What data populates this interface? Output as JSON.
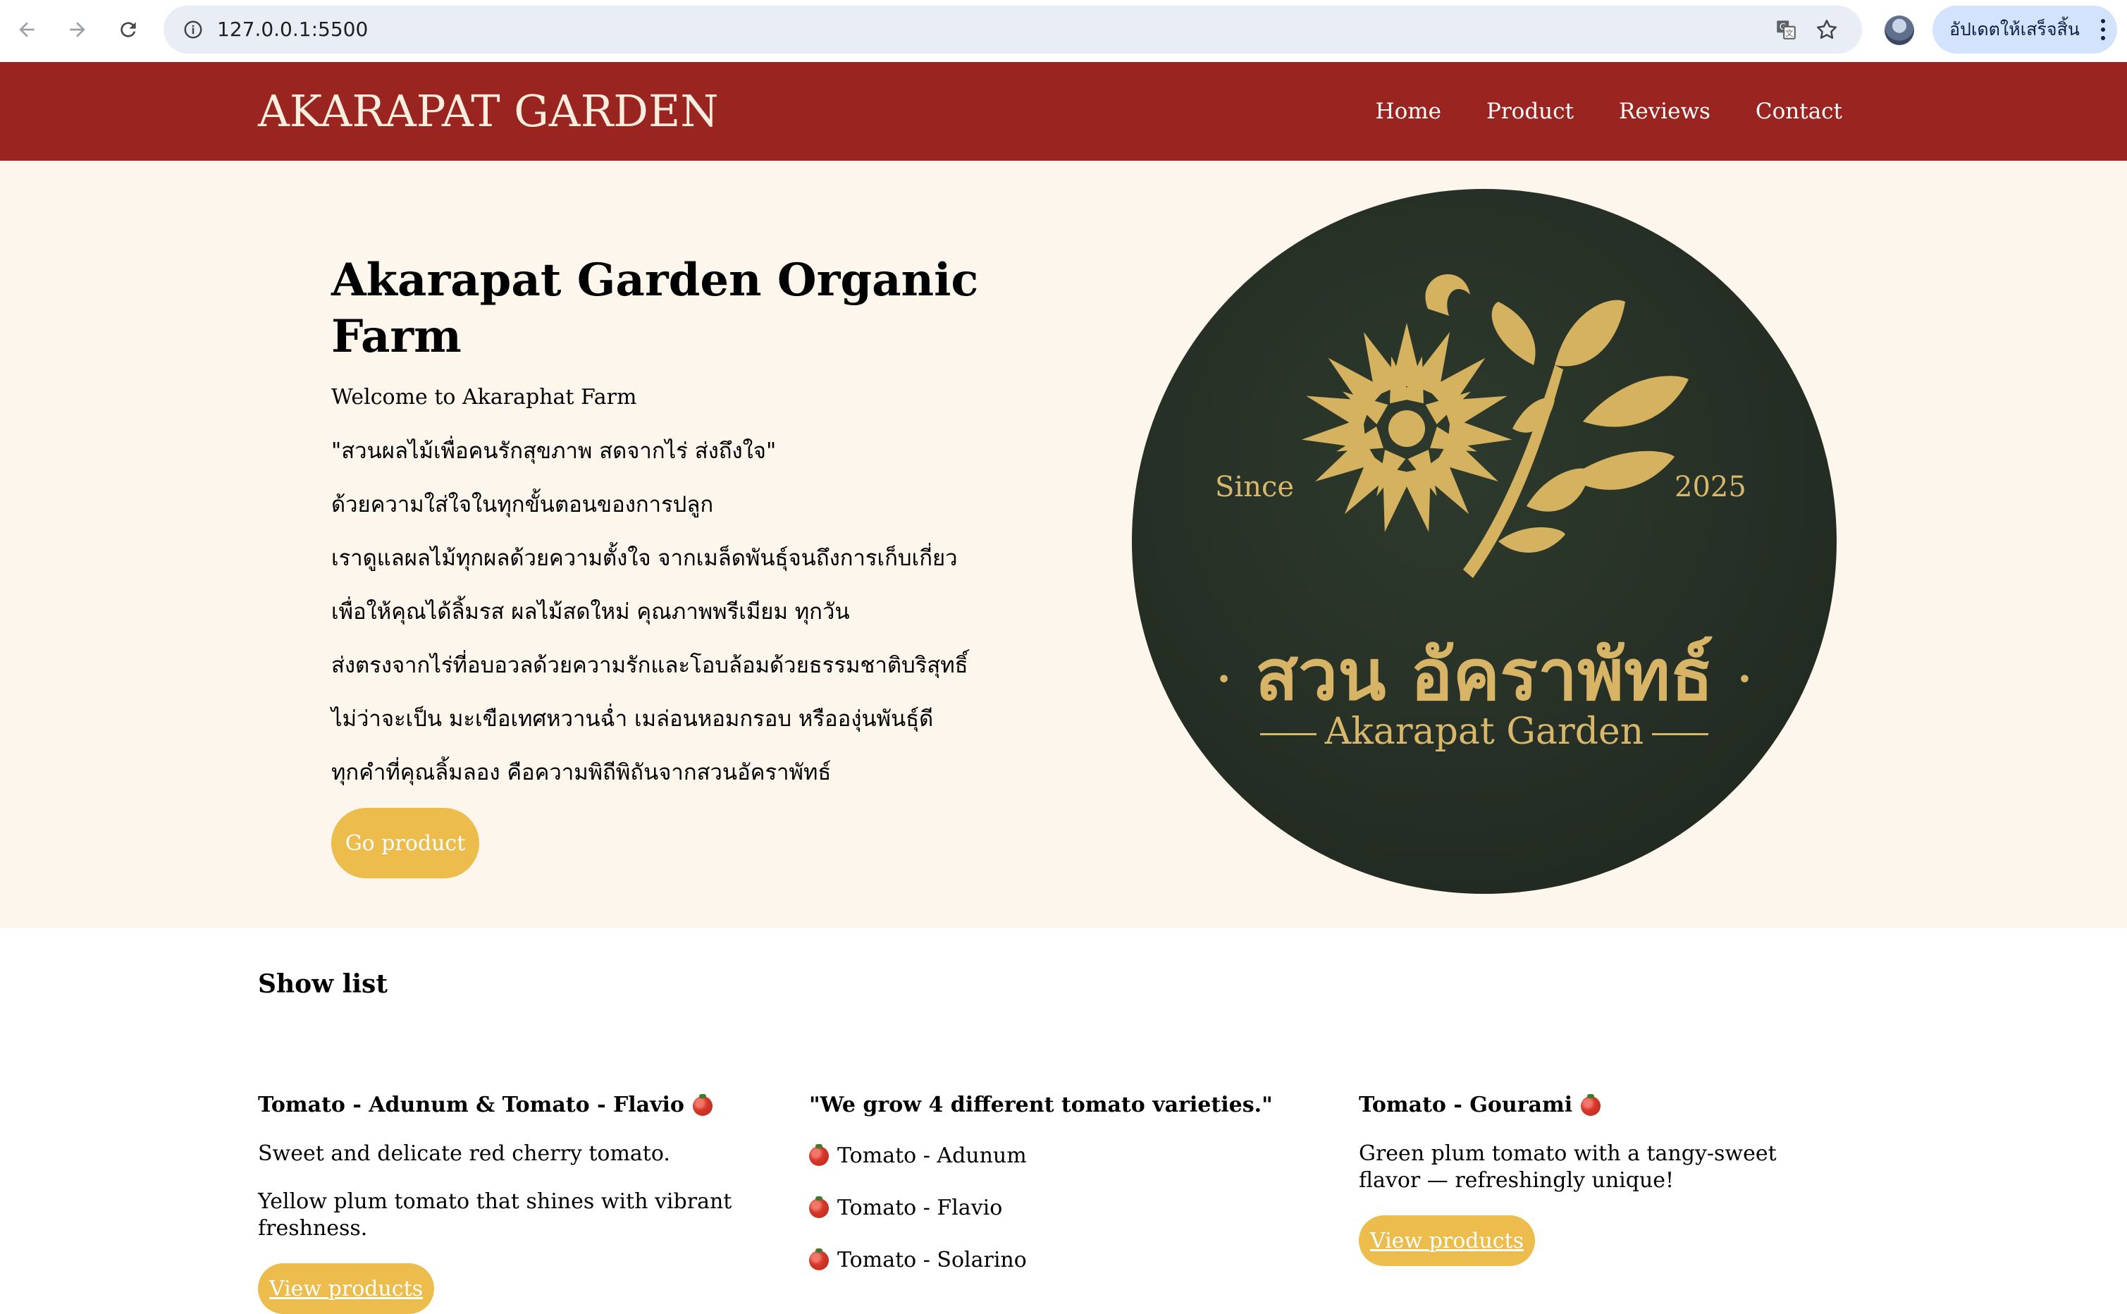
{
  "browser": {
    "url": "127.0.0.1:5500",
    "update_label": "อัปเดตให้เสร็จสิ้น"
  },
  "header": {
    "brand": "AKARAPAT GARDEN",
    "nav": [
      "Home",
      "Product",
      "Reviews",
      "Contact"
    ]
  },
  "hero": {
    "title": "Akarapat Garden Organic Farm",
    "welcome": "Welcome to Akaraphat Farm",
    "lines": [
      "\"สวนผลไม้เพื่อคนรักสุขภาพ สดจากไร่ ส่งถึงใจ\"",
      "ด้วยความใส่ใจในทุกขั้นตอนของการปลูก",
      "เราดูแลผลไม้ทุกผลด้วยความตั้งใจ จากเมล็ดพันธุ์จนถึงการเก็บเกี่ยว",
      "เพื่อให้คุณได้ลิ้มรส ผลไม้สดใหม่ คุณภาพพรีเมียม ทุกวัน",
      "ส่งตรงจากไร่ที่อบอวลด้วยความรักและโอบล้อมด้วยธรรมชาติบริสุทธิ์",
      "ไม่ว่าจะเป็น มะเขือเทศหวานฉ่ำ เมล่อนหอมกรอบ หรือองุ่นพันธุ์ดี",
      "ทุกคำที่คุณลิ้มลอง คือความพิถีพิถันจากสวนอัคราพัทธ์"
    ],
    "button": "Go product",
    "logo": {
      "since": "Since",
      "year": "2025",
      "thai_name": "สวน อัคราพัทธ์",
      "en_name": "Akarapat Garden"
    }
  },
  "show_list": {
    "title": "Show list",
    "col1": {
      "title": "Tomato - Adunum & Tomato - Flavio",
      "text1": "Sweet and delicate red cherry tomato.",
      "text2": "Yellow plum tomato that shines with vibrant freshness.",
      "button": "View products"
    },
    "col2": {
      "title": "\"We grow 4 different tomato varieties.\"",
      "items": [
        "Tomato - Adunum",
        "Tomato - Flavio",
        "Tomato - Solarino"
      ]
    },
    "col3": {
      "title": "Tomato - Gourami",
      "text1": "Green plum tomato with a tangy-sweet flavor — refreshingly unique!",
      "button": "View products"
    }
  },
  "colors": {
    "header_bg": "#9a2420",
    "hero_bg": "#fdf6ec",
    "button_bg": "#ecbc4c",
    "logo_bg": "#262f25",
    "logo_gold": "#d9b76a"
  },
  "icons": [
    "back-arrow-icon",
    "forward-arrow-icon",
    "reload-icon",
    "site-info-icon",
    "translate-icon",
    "bookmark-star-icon",
    "more-menu-icon",
    "tomato-icon"
  ]
}
